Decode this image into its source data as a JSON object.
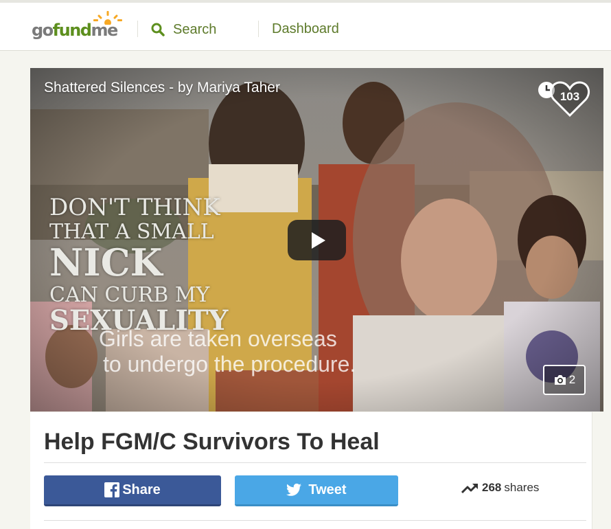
{
  "header": {
    "logo": {
      "go": "go",
      "fund": "fund",
      "me": "me"
    },
    "search_label": "Search",
    "dashboard_label": "Dashboard"
  },
  "media": {
    "video_title": "Shattered Silences - by Mariya Taher",
    "quote_lines": [
      "DON'T THINK",
      "THAT A SMALL",
      "NICK",
      "CAN CURB MY",
      "SEXUALITY"
    ],
    "subtitle_lines": [
      "Girls are taken overseas",
      "to undergo the procedure."
    ],
    "heart_count": "103",
    "photo_count": "2",
    "icons": [
      "clock-icon",
      "heart-icon",
      "play-icon",
      "camera-icon"
    ]
  },
  "campaign": {
    "title": "Help FGM/C Survivors To Heal",
    "share_label": "Share",
    "tweet_label": "Tweet",
    "shares_count": "268",
    "shares_label": "shares"
  },
  "colors": {
    "brand_green": "#5d8f1e",
    "facebook_blue": "#3b5998",
    "twitter_blue": "#4aa7e6"
  }
}
